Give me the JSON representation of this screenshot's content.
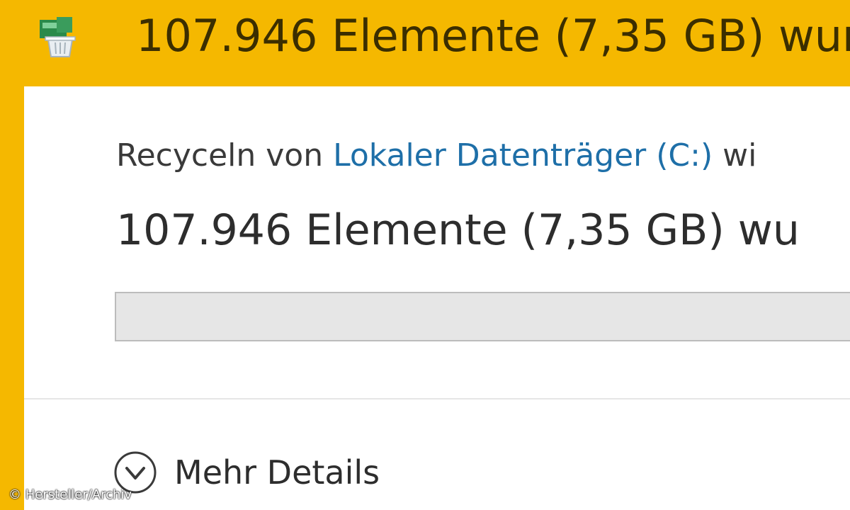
{
  "window": {
    "title": "107.946 Elemente (7,35 GB) wur",
    "icon": "recycle-bin-icon"
  },
  "status": {
    "prefix": "Recyceln von",
    "location_link": "Lokaler Datenträger (C:)",
    "suffix": "wi"
  },
  "main_message": "107.946 Elemente (7,35 GB) wu",
  "progress": {
    "percent": 0
  },
  "details_toggle": {
    "label": "Mehr Details",
    "icon": "chevron-down-icon"
  },
  "watermark": "© Hersteller/Archiv",
  "colors": {
    "accent": "#f5b800",
    "link": "#1e6fa8"
  }
}
